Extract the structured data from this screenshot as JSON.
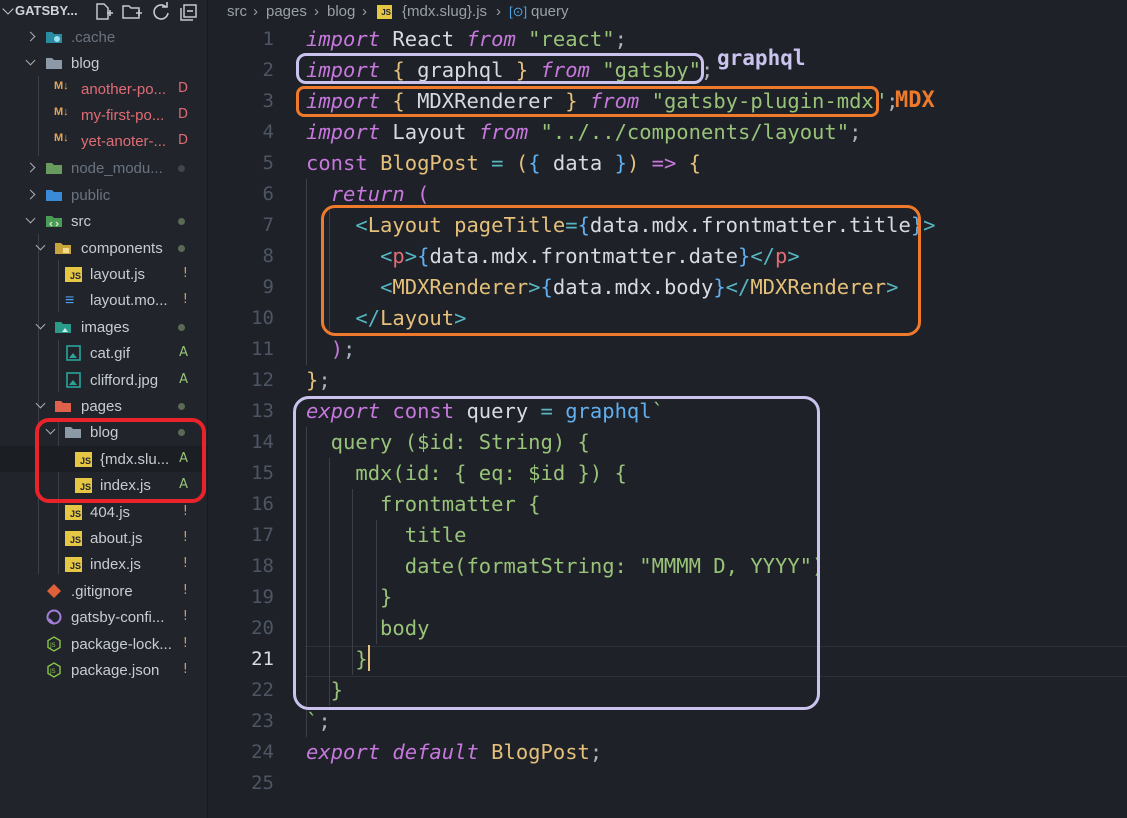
{
  "explorer": {
    "title": "GATSBY...",
    "items": [
      {
        "label": ".cache"
      },
      {
        "label": "blog"
      },
      {
        "label": "another-po...",
        "status": "D"
      },
      {
        "label": "my-first-po...",
        "status": "D"
      },
      {
        "label": "yet-anoter-...",
        "status": "D"
      },
      {
        "label": "node_modu..."
      },
      {
        "label": "public"
      },
      {
        "label": "src"
      },
      {
        "label": "components"
      },
      {
        "label": "layout.js",
        "status": "!"
      },
      {
        "label": "layout.mo...",
        "status": "!"
      },
      {
        "label": "images"
      },
      {
        "label": "cat.gif",
        "status": "A"
      },
      {
        "label": "clifford.jpg",
        "status": "A"
      },
      {
        "label": "pages"
      },
      {
        "label": "blog"
      },
      {
        "label": "{mdx.slu...",
        "status": "A"
      },
      {
        "label": "index.js",
        "status": "A"
      },
      {
        "label": "404.js",
        "status": "!"
      },
      {
        "label": "about.js",
        "status": "!"
      },
      {
        "label": "index.js",
        "status": "!"
      },
      {
        "label": ".gitignore",
        "status": "!"
      },
      {
        "label": "gatsby-confi...",
        "status": "!"
      },
      {
        "label": "package-lock...",
        "status": "!"
      },
      {
        "label": "package.json",
        "status": "!"
      }
    ]
  },
  "breadcrumb": [
    "src",
    "pages",
    "blog",
    "{mdx.slug}.js",
    "query"
  ],
  "editor": {
    "active_line": 21,
    "lines": [
      "1",
      "2",
      "3",
      "4",
      "5",
      "6",
      "7",
      "8",
      "9",
      "10",
      "11",
      "12",
      "13",
      "14",
      "15",
      "16",
      "17",
      "18",
      "19",
      "20",
      "21",
      "22",
      "23",
      "24",
      "25"
    ]
  },
  "annotations": {
    "graphql_label": "graphql",
    "mdx_label": "MDX",
    "colors": {
      "purple": "#c9c3ee",
      "orange": "#f07a2b",
      "red": "#e8232a"
    }
  },
  "colors": {
    "keyword": "#c678dd",
    "string": "#98c379",
    "type": "#e5c07b",
    "tag": "#e06c75",
    "bracket": "#61afef",
    "status_deleted": "#e06c75",
    "status_added": "#98c379",
    "status_modified": "#d19a66"
  }
}
